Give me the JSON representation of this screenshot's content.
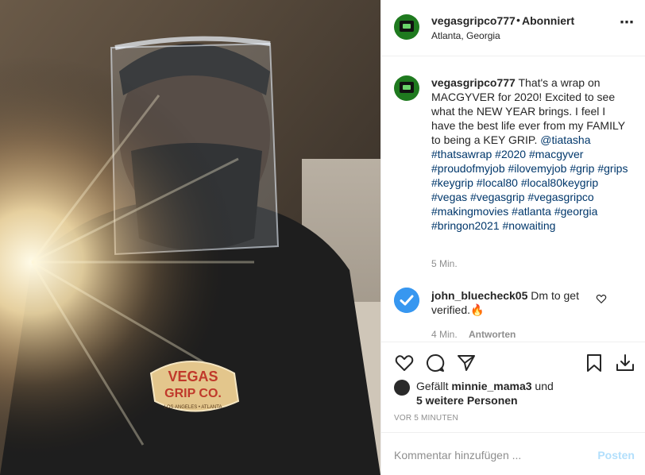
{
  "header": {
    "username": "vegasgripco777",
    "separator": "•",
    "follow_status": "Abonniert",
    "location": "Atlanta, Georgia",
    "more_icon": "more-options-icon"
  },
  "caption": {
    "username": "vegasgripco777",
    "text_plain": "That's a wrap on MACGYVER for 2020! Excited to see what the NEW YEAR brings. I feel I have the best life ever from my FAMILY to being a KEY GRIP.",
    "tags": "@tiatasha #thatsawrap #2020 #macgyver #proudofmyjob #ilovemyjob #grip #grips #keygrip #local80 #local80keygrip #vegas #vegasgrip #vegasgripco #makingmovies #atlanta #georgia #bringon2021 #nowaiting",
    "time": "5 Min."
  },
  "comment": {
    "username": "john_bluecheck05",
    "text": "Dm to get verified.🔥",
    "time": "4 Min.",
    "reply_label": "Antworten"
  },
  "actions": {
    "icons": [
      "heart-icon",
      "comment-icon",
      "share-icon",
      "bookmark-icon",
      "download-icon"
    ]
  },
  "likes": {
    "prefix": "Gefällt",
    "user": "minnie_mama3",
    "joiner": "und",
    "others": "5 weitere Personen"
  },
  "timestamp": "VOR 5 MINUTEN",
  "comment_box": {
    "placeholder": "Kommentar hinzufügen ...",
    "post_label": "Posten"
  },
  "photo": {
    "shirt_line1": "VEGAS",
    "shirt_line2": "GRIP CO.",
    "shirt_line3": "LOS ANGELES • ATLANTA"
  },
  "colors": {
    "link": "#00376b",
    "verified_blue": "#3797f0",
    "post_disabled": "#b2dffc",
    "muted": "#8e8e8e"
  }
}
